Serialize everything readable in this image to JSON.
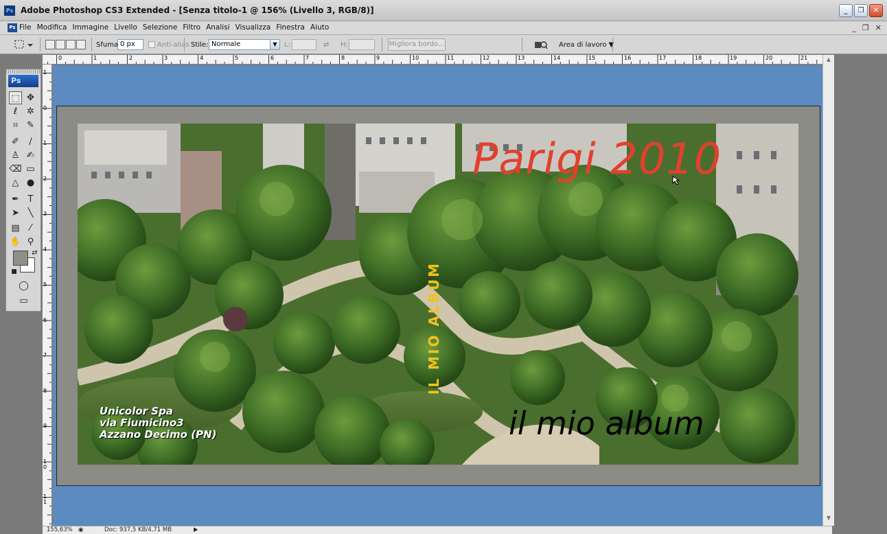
{
  "window": {
    "app_icon": "Ps",
    "title": "Adobe Photoshop CS3 Extended - [Senza titolo-1 @ 156% (Livello 3, RGB/8)]",
    "buttons": [
      "_",
      "❐",
      "✕"
    ]
  },
  "menubar": {
    "doc_icon": "Ps",
    "items": [
      "File",
      "Modifica",
      "Immagine",
      "Livello",
      "Selezione",
      "Filtro",
      "Analisi",
      "Visualizza",
      "Finestra",
      "Aiuto"
    ],
    "mdi_buttons": [
      "_",
      "❐",
      "✕"
    ]
  },
  "options": {
    "sfuma_label": "Sfuma:",
    "sfuma_value": "0 px",
    "antialias_label": "Anti-alias",
    "stile_label": "Stile:",
    "stile_value": "Normale",
    "l_label": "L:",
    "h_label": "H:",
    "migliora_label": "Migliora bordo...",
    "area_label": "Area di lavoro ▼"
  },
  "ruler": {
    "h_ticks": [
      "0",
      "1",
      "2",
      "3",
      "4",
      "5",
      "6",
      "7",
      "8",
      "9",
      "10",
      "11",
      "12",
      "13",
      "14",
      "15",
      "16",
      "17",
      "18",
      "19",
      "20",
      "21"
    ],
    "v_ticks": [
      "1",
      "0",
      "1",
      "2",
      "3",
      "4",
      "5",
      "6",
      "7",
      "8",
      "9",
      "1 0",
      "1 1"
    ]
  },
  "toolbox": {
    "logo": "Ps"
  },
  "canvas": {
    "title_text": "Parigi 2010",
    "vertical_text": "IL MIO ALBUM",
    "album_text": "il mio album",
    "address_lines": [
      "Unicolor Spa",
      "via Fiumicino3",
      "Azzano Decimo (PN)"
    ]
  },
  "status": {
    "zoom": "155,63%",
    "doc": "Doc: 937,5 KB/4,71 MB"
  },
  "colors": {
    "canvas_bg": "#5b8bc0",
    "frame": "#8c8c86",
    "title_red": "#e0412e",
    "vertical_yellow": "#f2c21b"
  }
}
